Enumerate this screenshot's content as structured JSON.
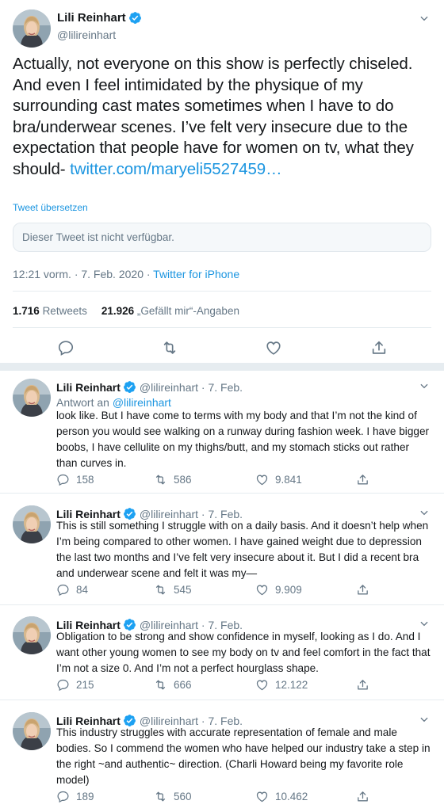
{
  "main": {
    "author_name": "Lili Reinhart",
    "author_handle": "@lilireinhart",
    "text": "Actually, not everyone on this show is perfectly chiseled. And even I feel intimidated by the physique of my surrounding cast mates sometimes when I have to do bra/underwear scenes. I’ve felt very insecure due to the expectation that people have for women on tv, what they should- ",
    "link": "twitter.com/maryeli5527459…",
    "translate_label": "Tweet übersetzen",
    "unavailable_text": "Dieser Tweet ist nicht verfügbar.",
    "timestamp": "12:21 vorm. · 7. Feb. 2020 · ",
    "source": "Twitter for iPhone",
    "retweets_count": "1.716",
    "retweets_label": "Retweets",
    "likes_count": "21.926",
    "likes_label": "„Gefällt mir“-Angaben"
  },
  "replies": [
    {
      "name": "Lili Reinhart",
      "handle": "@lilireinhart · 7. Feb.",
      "reply_to_label": "Antwort an ",
      "reply_to_handle": "@lilireinhart",
      "text": "look like. But I have come to terms with my body and that I’m not the kind of person you would see walking on a runway during fashion week. I have bigger boobs, I have cellulite on my thighs/butt, and my stomach sticks out rather than curves in.",
      "replies": "158",
      "retweets": "586",
      "likes": "9.841"
    },
    {
      "name": "Lili Reinhart",
      "handle": "@lilireinhart · 7. Feb.",
      "text": "This is still something I struggle with on a daily basis. And it doesn’t help when I’m being compared to other women. I have gained weight due to depression the last two months and I’ve felt very insecure about it. But I did a recent bra and underwear scene and felt it was my—",
      "replies": "84",
      "retweets": "545",
      "likes": "9.909"
    },
    {
      "name": "Lili Reinhart",
      "handle": "@lilireinhart · 7. Feb.",
      "text": "Obligation to be strong and show confidence in myself, looking as I do. And I want other young women to see my body on tv and feel comfort in the fact that I’m not a size 0. And I’m not a perfect hourglass shape.",
      "replies": "215",
      "retweets": "666",
      "likes": "12.122"
    },
    {
      "name": "Lili Reinhart",
      "handle": "@lilireinhart · 7. Feb.",
      "text": "This industry struggles with accurate representation of female and male bodies. So I commend the women who have helped our industry take a step in the right ~and authentic~ direction. (Charli Howard being my favorite role model)",
      "replies": "189",
      "retweets": "560",
      "likes": "10.462"
    }
  ],
  "colors": {
    "link": "#1b95e0",
    "muted": "#657786",
    "text": "#14171a",
    "verified": "#1da1f2"
  },
  "icons": [
    "verified-badge-icon",
    "chevron-down-icon",
    "reply-icon",
    "retweet-icon",
    "like-icon",
    "share-icon"
  ]
}
